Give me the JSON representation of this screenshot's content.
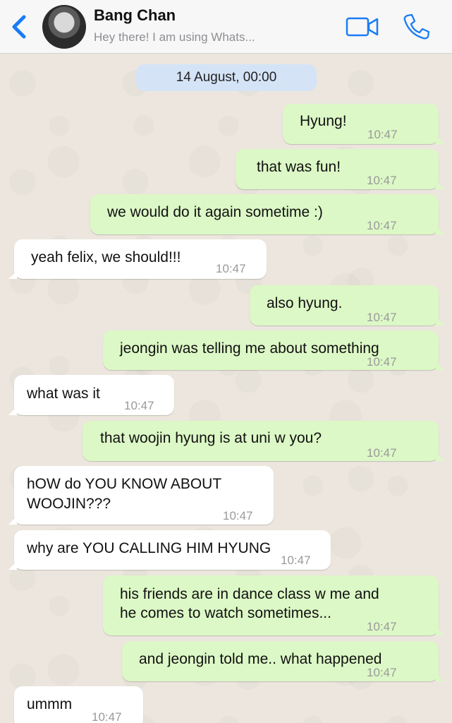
{
  "header": {
    "contact_name": "Bang Chan",
    "contact_status": "Hey there! I am using Whats...",
    "accent_color": "#1a7cf5",
    "icons": {
      "back": "chevron-left-icon",
      "video": "video-camera-icon",
      "call": "phone-icon"
    }
  },
  "date_divider": "14 August, 00:00",
  "messages": [
    {
      "direction": "out",
      "text": "Hyung!",
      "time": "10:47"
    },
    {
      "direction": "out",
      "text": "that was fun!",
      "time": "10:47"
    },
    {
      "direction": "out",
      "text": "we would do it again sometime :)",
      "time": "10:47"
    },
    {
      "direction": "in",
      "text": "yeah felix, we should!!!",
      "time": "10:47"
    },
    {
      "direction": "out",
      "text": "also hyung.",
      "time": "10:47"
    },
    {
      "direction": "out",
      "text": "jeongin was telling me about something",
      "time": "10:47"
    },
    {
      "direction": "in",
      "text": "what was it",
      "time": "10:47"
    },
    {
      "direction": "out",
      "text": "that woojin hyung is at uni w you?",
      "time": "10:47"
    },
    {
      "direction": "in",
      "text_line1": "hOW do YOU KNOW ABOUT",
      "text_line2": "WOOJIN???",
      "time": "10:47"
    },
    {
      "direction": "in",
      "text": "why are YOU CALLING HIM HYUNG",
      "time": "10:47"
    },
    {
      "direction": "out",
      "text_line1": "his friends are in dance class w me and",
      "text_line2": "he comes to watch sometimes...",
      "time": "10:47"
    },
    {
      "direction": "out",
      "text": "and jeongin told me.. what happened",
      "time": "10:47"
    },
    {
      "direction": "in",
      "text": "ummm",
      "time": "10:47"
    }
  ],
  "colors": {
    "outgoing_bubble": "#dcf8c6",
    "incoming_bubble": "#ffffff",
    "date_pill": "#d5e3f7"
  }
}
